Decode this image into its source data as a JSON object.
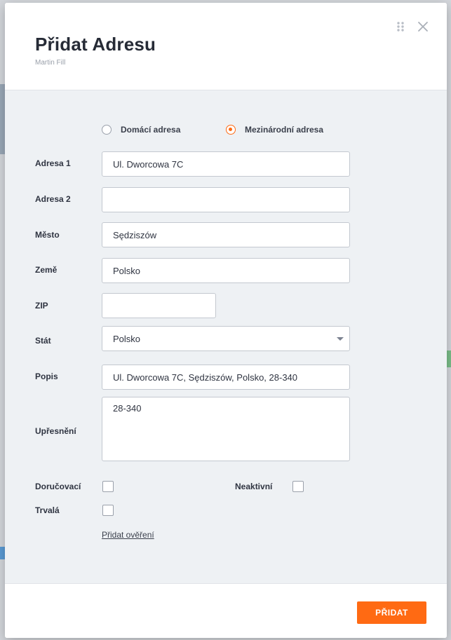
{
  "modal": {
    "title": "Přidat Adresu",
    "subtitle": "Martin Fill"
  },
  "address_type": {
    "options": [
      {
        "label": "Domácí adresa",
        "checked": false
      },
      {
        "label": "Mezinárodní adresa",
        "checked": true
      }
    ]
  },
  "fields": {
    "address1": {
      "label": "Adresa 1",
      "value": "Ul. Dworcowa 7C"
    },
    "address2": {
      "label": "Adresa 2",
      "value": ""
    },
    "city": {
      "label": "Město",
      "value": "Sędziszów"
    },
    "country": {
      "label": "Země",
      "value": "Polsko"
    },
    "zip": {
      "label": "ZIP",
      "value": ""
    },
    "state": {
      "label": "Stát",
      "value": "Polsko"
    },
    "description": {
      "label": "Popis",
      "value": "Ul. Dworcowa 7C, Sędziszów, Polsko, 28-340"
    },
    "detail": {
      "label": "Upřesnění",
      "value": "28-340"
    }
  },
  "checkboxes": {
    "delivery": {
      "label": "Doručovací",
      "checked": false
    },
    "inactive": {
      "label": "Neaktivní",
      "checked": false
    },
    "permanent": {
      "label": "Trvalá",
      "checked": false
    }
  },
  "add_verification_link": "Přidat ověření",
  "footer": {
    "submit_label": "PŘIDAT"
  },
  "colors": {
    "accent": "#ff6a13",
    "body_bg": "#eef1f4"
  }
}
